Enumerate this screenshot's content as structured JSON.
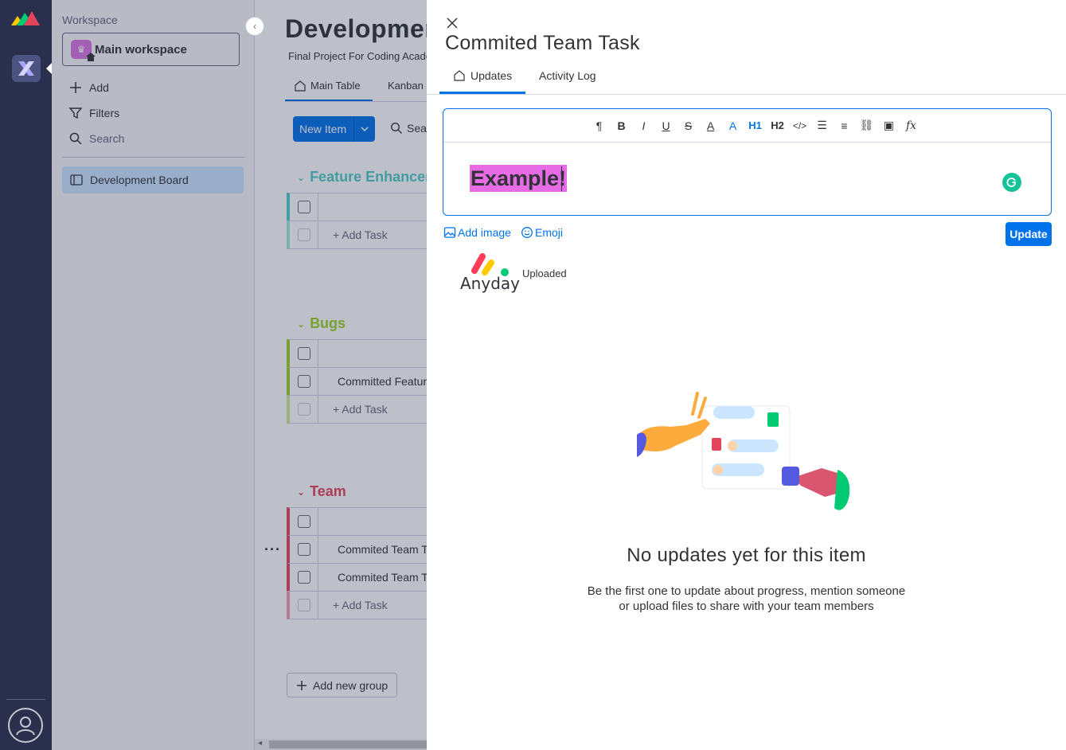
{
  "workspace": {
    "label": "Workspace",
    "name": "Main workspace",
    "menu": {
      "add": "Add",
      "filters": "Filters",
      "search": "Search"
    },
    "boards": [
      "Development Board"
    ]
  },
  "board": {
    "title": "Development Board",
    "description": "Final Project For Coding Academy",
    "tabs": [
      "Main Table",
      "Kanban"
    ],
    "new_item": "New Item",
    "search": "Search",
    "groups": [
      {
        "title": "Feature Enhancements",
        "color": "#4eccc6",
        "rows": [],
        "add": "+ Add Task"
      },
      {
        "title": "Bugs",
        "color": "#9cd326",
        "rows": [
          "Committed Feature"
        ],
        "add": "+ Add Task"
      },
      {
        "title": "Team",
        "color": "#e2445c",
        "rows": [
          "Commited Team Task",
          "Commited Team Task"
        ],
        "add": "+ Add Task"
      }
    ],
    "add_group": "Add new group"
  },
  "panel": {
    "title": "Commited Team Task",
    "tabs": {
      "updates": "Updates",
      "activity": "Activity Log"
    },
    "editor_text": "Example!",
    "add_image": "Add image",
    "emoji": "Emoji",
    "update_button": "Update",
    "logo_word": "Anyday",
    "uploaded": "Uploaded",
    "empty_title": "No updates yet for this item",
    "empty_sub_1": "Be the first one to update about progress, mention someone",
    "empty_sub_2": "or upload files to share with your team members"
  },
  "colors": {
    "accent": "#0073ea",
    "rail": "#292f4c",
    "highlight": "#e86be6"
  }
}
